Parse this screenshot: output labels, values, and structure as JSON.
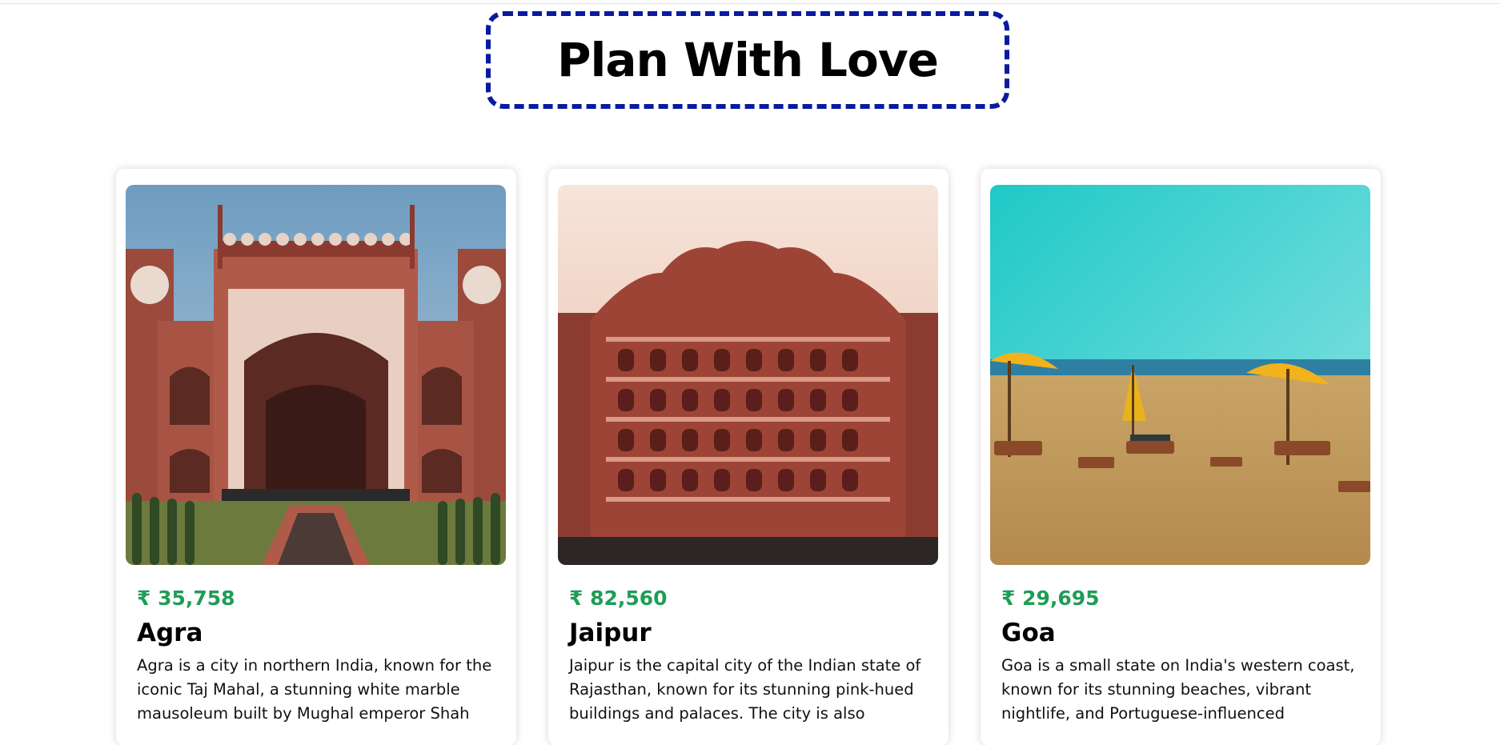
{
  "page": {
    "title": "Plan With Love",
    "accent_color": "#0a1aa0",
    "price_color": "#1f9d55"
  },
  "cards": [
    {
      "price": "₹ 35,758",
      "city": "Agra",
      "description": "Agra is a city in northern India, known for the iconic Taj Mahal, a stunning white marble mausoleum built by Mughal emperor Shah"
    },
    {
      "price": "₹ 82,560",
      "city": "Jaipur",
      "description": "Jaipur is the capital city of the Indian state of Rajasthan, known for its stunning pink-hued buildings and palaces. The city is also"
    },
    {
      "price": "₹ 29,695",
      "city": "Goa",
      "description": "Goa is a small state on India's western coast, known for its stunning beaches, vibrant nightlife, and Portuguese-influenced"
    }
  ]
}
